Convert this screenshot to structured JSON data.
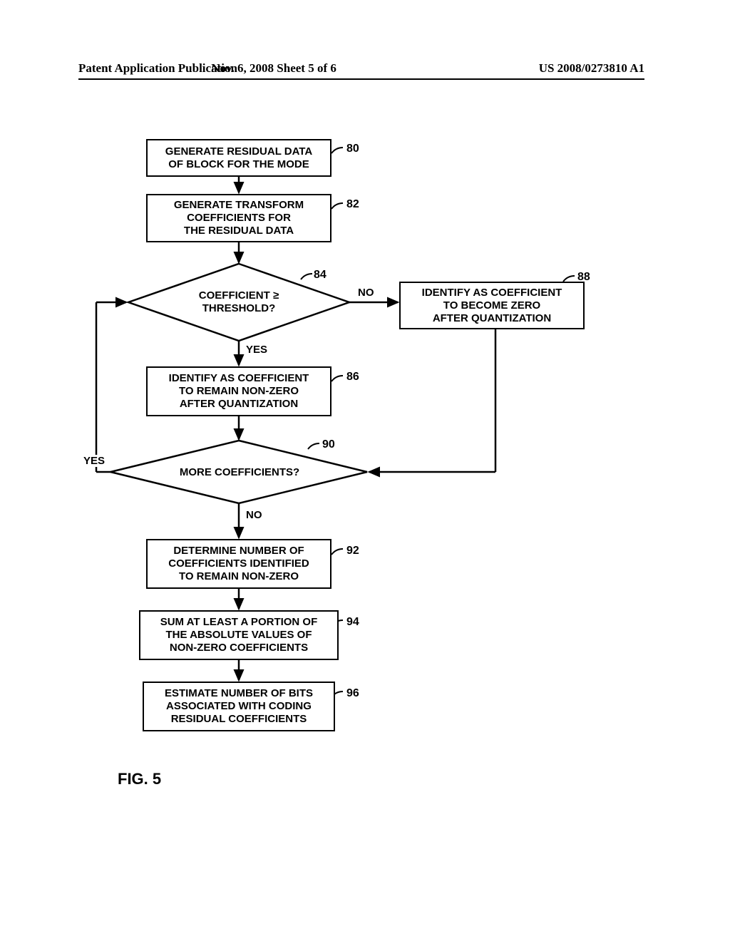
{
  "header": {
    "left": "Patent Application Publication",
    "center": "Nov. 6, 2008  Sheet 5 of 6",
    "right": "US 2008/0273810 A1"
  },
  "figure_label": "FIG. 5",
  "steps": {
    "s80": {
      "ref": "80",
      "text": "GENERATE RESIDUAL DATA\nOF BLOCK FOR THE MODE"
    },
    "s82": {
      "ref": "82",
      "text": "GENERATE TRANSFORM\nCOEFFICIENTS FOR\nTHE RESIDUAL DATA"
    },
    "s84": {
      "ref": "84",
      "text": "COEFFICIENT ≥\nTHRESHOLD?"
    },
    "s86": {
      "ref": "86",
      "text": "IDENTIFY AS COEFFICIENT\nTO REMAIN NON-ZERO\nAFTER QUANTIZATION"
    },
    "s88": {
      "ref": "88",
      "text": "IDENTIFY AS COEFFICIENT\nTO BECOME ZERO\nAFTER QUANTIZATION"
    },
    "s90": {
      "ref": "90",
      "text": "MORE COEFFICIENTS?"
    },
    "s92": {
      "ref": "92",
      "text": "DETERMINE NUMBER OF\nCOEFFICIENTS IDENTIFIED\nTO REMAIN NON-ZERO"
    },
    "s94": {
      "ref": "94",
      "text": "SUM AT LEAST A PORTION OF\nTHE ABSOLUTE VALUES OF\nNON-ZERO COEFFICIENTS"
    },
    "s96": {
      "ref": "96",
      "text": "ESTIMATE NUMBER OF BITS\nASSOCIATED WITH CODING\nRESIDUAL COEFFICIENTS"
    }
  },
  "labels": {
    "yes": "YES",
    "no": "NO"
  }
}
